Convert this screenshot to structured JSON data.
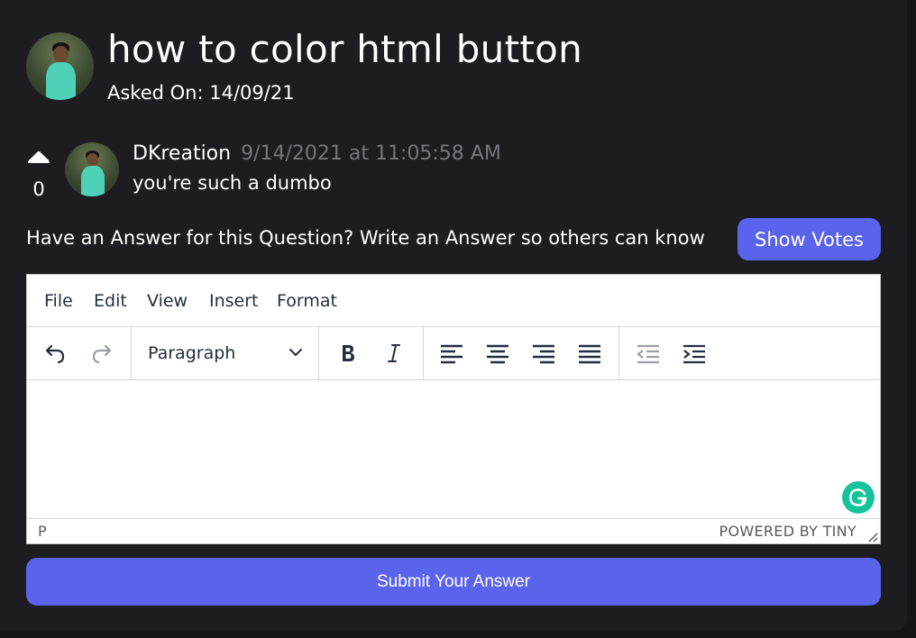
{
  "question": {
    "title": "how to color html button",
    "asked_on": "Asked On: 14/09/21"
  },
  "comment": {
    "votes": "0",
    "author": "DKreation",
    "timestamp": "9/14/2021 at 11:05:58 AM",
    "text": "you're such a dumbo"
  },
  "answer_prompt": "Have an Answer for this Question? Write an Answer so others can know",
  "show_votes_label": "Show Votes",
  "editor": {
    "menu": [
      "File",
      "Edit",
      "View",
      "Insert",
      "Format"
    ],
    "block_format": "Paragraph",
    "status_path": "P",
    "branding": "POWERED BY TINY",
    "toolbar_icons": [
      "undo-icon",
      "redo-icon",
      "bold-icon",
      "italic-icon",
      "align-left-icon",
      "align-center-icon",
      "align-right-icon",
      "align-justify-icon",
      "outdent-icon",
      "indent-icon"
    ]
  },
  "submit_label": "Submit Your Answer",
  "colors": {
    "background": "#1c1c21",
    "accent": "#5a63eb",
    "timestamp": "#75757d",
    "grammarly": "#15c39a"
  }
}
